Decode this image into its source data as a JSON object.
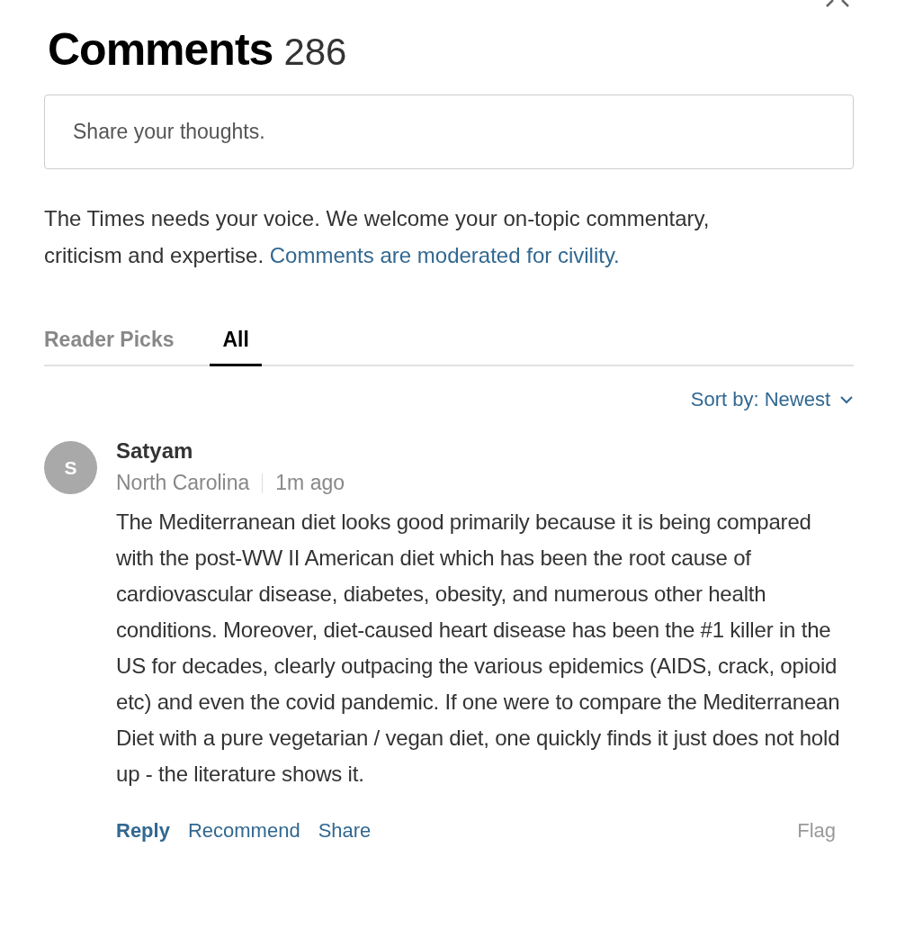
{
  "header": {
    "title": "Comments",
    "count": "286"
  },
  "composer": {
    "placeholder": "Share your thoughts."
  },
  "intro": {
    "text": "The Times needs your voice. We welcome your on-topic commentary, criticism and expertise.",
    "link": "Comments are moderated for civility."
  },
  "tabs": [
    {
      "label": "Reader Picks",
      "selected": false
    },
    {
      "label": "All",
      "selected": true
    }
  ],
  "sort": {
    "label": "Sort by: Newest"
  },
  "comments": [
    {
      "initial": "S",
      "author": "Satyam",
      "location": "North Carolina",
      "time": "1m ago",
      "body": "The Mediterranean diet looks good primarily because it is being compared with the post-WW II American diet which has been the root cause of cardiovascular disease, diabetes, obesity, and numerous other health conditions. Moreover, diet-caused heart disease has been the #1 killer in the US for decades, clearly outpacing the various epidemics (AIDS, crack, opioid etc) and even the covid pandemic. If one were to compare the Mediterranean Diet with a pure vegetarian / vegan diet, one quickly finds it just does not hold up - the literature shows it.",
      "actions": [
        {
          "label": "Reply",
          "kind": "primary"
        },
        {
          "label": "Recommend",
          "kind": "secondary"
        },
        {
          "label": "Share",
          "kind": "secondary"
        },
        {
          "label": "Flag",
          "kind": "flag"
        }
      ]
    }
  ]
}
